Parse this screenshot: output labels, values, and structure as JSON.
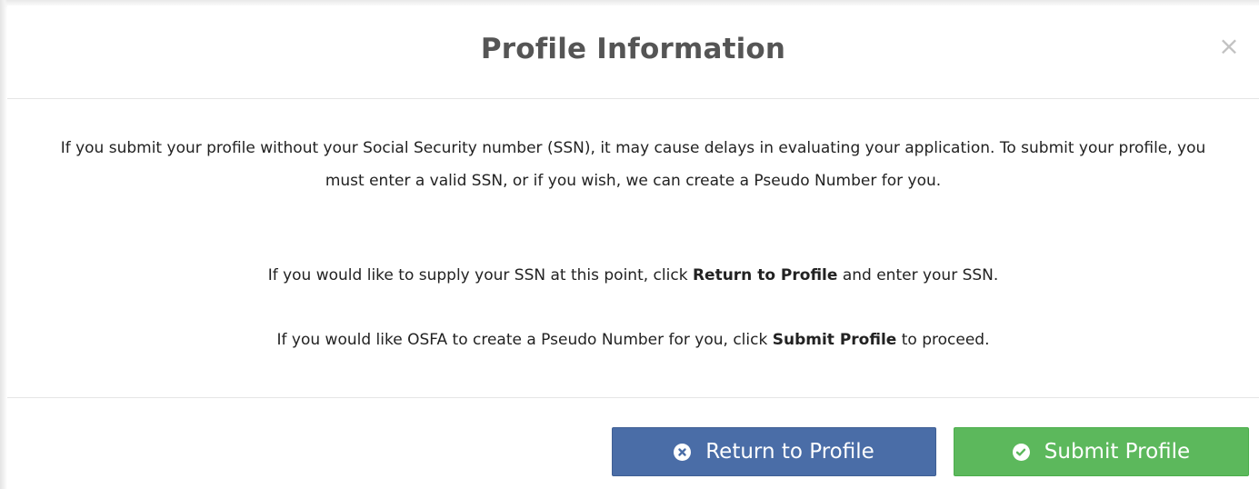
{
  "modal": {
    "title": "Profile Information",
    "close_label": "×"
  },
  "body": {
    "paragraph1": "If you submit your profile without your Social Security number (SSN), it may cause delays in evaluating your application. To submit your profile, you must enter a valid SSN, or if you wish, we can create a Pseudo Number for you.",
    "paragraph2": {
      "before": "If you would like to supply your SSN at this point, click ",
      "bold": "Return to Profile",
      "after": " and enter your SSN."
    },
    "paragraph3": {
      "before": "If you would like OSFA to create a Pseudo Number for you, click ",
      "bold": "Submit Profile",
      "after": " to proceed."
    }
  },
  "footer": {
    "return_button": {
      "label": "Return to Profile",
      "icon": "times-circle-icon",
      "color": "#4a6da7"
    },
    "submit_button": {
      "label": "Submit Profile",
      "icon": "check-circle-icon",
      "color": "#5cb85c"
    }
  }
}
